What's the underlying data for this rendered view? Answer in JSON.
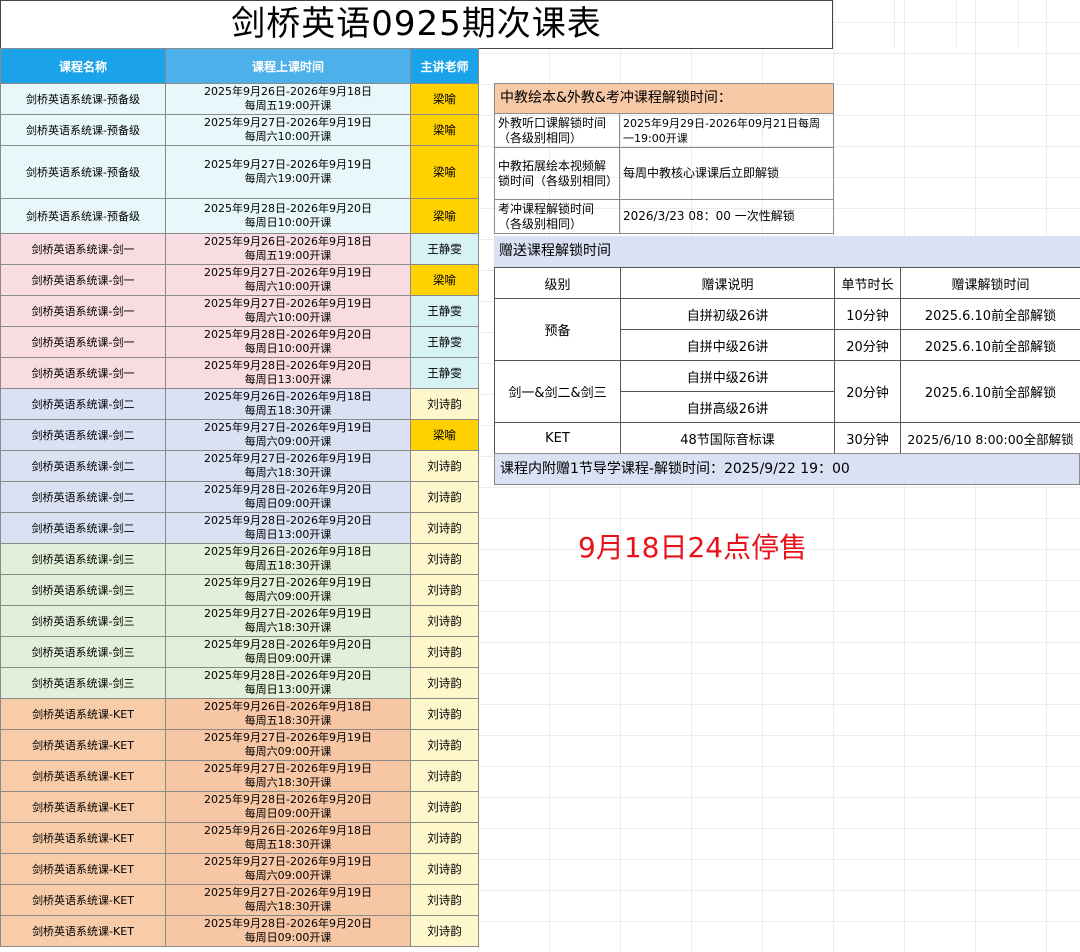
{
  "title": "剑桥英语0925期次课表",
  "schedule": {
    "headers": [
      "课程名称",
      "课程上课时间",
      "主讲老师"
    ],
    "rows": [
      {
        "name": "剑桥英语系统课-预备级",
        "date": "2025年9月26日-2026年9月18日",
        "time": "每周五19:00开课",
        "teacher": "梁喻",
        "group": "pre",
        "tcolor": "gold"
      },
      {
        "name": "剑桥英语系统课-预备级",
        "date": "2025年9月27日-2026年9月19日",
        "time": "每周六10:00开课",
        "teacher": "梁喻",
        "group": "pre",
        "tcolor": "gold"
      },
      {
        "name": "剑桥英语系统课-预备级",
        "date": "2025年9月27日-2026年9月19日",
        "time": "每周六19:00开课",
        "teacher": "梁喻",
        "group": "pre",
        "tcolor": "gold"
      },
      {
        "name": "剑桥英语系统课-预备级",
        "date": "2025年9月28日-2026年9月20日",
        "time": "每周日10:00开课",
        "teacher": "梁喻",
        "group": "pre",
        "tcolor": "gold"
      },
      {
        "name": "剑桥英语系统课-剑一",
        "date": "2025年9月26日-2026年9月18日",
        "time": "每周五19:00开课",
        "teacher": "王静雯",
        "group": "j1",
        "tcolor": "cyan"
      },
      {
        "name": "剑桥英语系统课-剑一",
        "date": "2025年9月27日-2026年9月19日",
        "time": "每周六10:00开课",
        "teacher": "梁喻",
        "group": "j1",
        "tcolor": "gold"
      },
      {
        "name": "剑桥英语系统课-剑一",
        "date": "2025年9月27日-2026年9月19日",
        "time": "每周六10:00开课",
        "teacher": "王静雯",
        "group": "j1",
        "tcolor": "cyan"
      },
      {
        "name": "剑桥英语系统课-剑一",
        "date": "2025年9月28日-2026年9月20日",
        "time": "每周日10:00开课",
        "teacher": "王静雯",
        "group": "j1",
        "tcolor": "cyan"
      },
      {
        "name": "剑桥英语系统课-剑一",
        "date": "2025年9月28日-2026年9月20日",
        "time": "每周日13:00开课",
        "teacher": "王静雯",
        "group": "j1",
        "tcolor": "cyan"
      },
      {
        "name": "剑桥英语系统课-剑二",
        "date": "2025年9月26日-2026年9月18日",
        "time": "每周五18:30开课",
        "teacher": "刘诗韵",
        "group": "j2",
        "tcolor": "cream"
      },
      {
        "name": "剑桥英语系统课-剑二",
        "date": "2025年9月27日-2026年9月19日",
        "time": "每周六09:00开课",
        "teacher": "梁喻",
        "group": "j2",
        "tcolor": "gold"
      },
      {
        "name": "剑桥英语系统课-剑二",
        "date": "2025年9月27日-2026年9月19日",
        "time": "每周六18:30开课",
        "teacher": "刘诗韵",
        "group": "j2",
        "tcolor": "cream"
      },
      {
        "name": "剑桥英语系统课-剑二",
        "date": "2025年9月28日-2026年9月20日",
        "time": "每周日09:00开课",
        "teacher": "刘诗韵",
        "group": "j2",
        "tcolor": "cream"
      },
      {
        "name": "剑桥英语系统课-剑二",
        "date": "2025年9月28日-2026年9月20日",
        "time": "每周日13:00开课",
        "teacher": "刘诗韵",
        "group": "j2",
        "tcolor": "cream"
      },
      {
        "name": "剑桥英语系统课-剑三",
        "date": "2025年9月26日-2026年9月18日",
        "time": "每周五18:30开课",
        "teacher": "刘诗韵",
        "group": "j3",
        "tcolor": "cream"
      },
      {
        "name": "剑桥英语系统课-剑三",
        "date": "2025年9月27日-2026年9月19日",
        "time": "每周六09:00开课",
        "teacher": "刘诗韵",
        "group": "j3",
        "tcolor": "cream"
      },
      {
        "name": "剑桥英语系统课-剑三",
        "date": "2025年9月27日-2026年9月19日",
        "time": "每周六18:30开课",
        "teacher": "刘诗韵",
        "group": "j3",
        "tcolor": "cream"
      },
      {
        "name": "剑桥英语系统课-剑三",
        "date": "2025年9月28日-2026年9月20日",
        "time": "每周日09:00开课",
        "teacher": "刘诗韵",
        "group": "j3",
        "tcolor": "cream"
      },
      {
        "name": "剑桥英语系统课-剑三",
        "date": "2025年9月28日-2026年9月20日",
        "time": "每周日13:00开课",
        "teacher": "刘诗韵",
        "group": "j3",
        "tcolor": "cream"
      },
      {
        "name": "剑桥英语系统课-KET",
        "date": "2025年9月26日-2026年9月18日",
        "time": "每周五18:30开课",
        "teacher": "刘诗韵",
        "group": "ket",
        "tcolor": "cream"
      },
      {
        "name": "剑桥英语系统课-KET",
        "date": "2025年9月27日-2026年9月19日",
        "time": "每周六09:00开课",
        "teacher": "刘诗韵",
        "group": "ket",
        "tcolor": "cream"
      },
      {
        "name": "剑桥英语系统课-KET",
        "date": "2025年9月27日-2026年9月19日",
        "time": "每周六18:30开课",
        "teacher": "刘诗韵",
        "group": "ket",
        "tcolor": "cream"
      },
      {
        "name": "剑桥英语系统课-KET",
        "date": "2025年9月28日-2026年9月20日",
        "time": "每周日09:00开课",
        "teacher": "刘诗韵",
        "group": "ket",
        "tcolor": "cream"
      },
      {
        "name": "剑桥英语系统课-KET",
        "date": "2025年9月26日-2026年9月18日",
        "time": "每周五18:30开课",
        "teacher": "刘诗韵",
        "group": "ket",
        "tcolor": "cream"
      },
      {
        "name": "剑桥英语系统课-KET",
        "date": "2025年9月27日-2026年9月19日",
        "time": "每周六09:00开课",
        "teacher": "刘诗韵",
        "group": "ket",
        "tcolor": "cream"
      },
      {
        "name": "剑桥英语系统课-KET",
        "date": "2025年9月27日-2026年9月19日",
        "time": "每周六18:30开课",
        "teacher": "刘诗韵",
        "group": "ket",
        "tcolor": "cream"
      },
      {
        "name": "剑桥英语系统课-KET",
        "date": "2025年9月28日-2026年9月20日",
        "time": "每周日09:00开课",
        "teacher": "刘诗韵",
        "group": "ket",
        "tcolor": "cream"
      }
    ]
  },
  "unlock": {
    "header": "中教绘本&外教&考冲课程解锁时间：",
    "rows": [
      {
        "label": "外教听口课解锁时间（各级别相同）",
        "value": "2025年9月29日-2026年09月21日每周一19:00开课"
      },
      {
        "label": "中教拓展绘本视频解锁时间（各级别相同）",
        "value": "每周中教核心课课后立即解锁"
      },
      {
        "label": "考冲课程解锁时间（各级别相同）",
        "value": "2026/3/23 08：00 一次性解锁"
      }
    ]
  },
  "gift": {
    "header": "赠送课程解锁时间",
    "columns": [
      "级别",
      "赠课说明",
      "单节时长",
      "赠课解锁时间"
    ],
    "groups": [
      {
        "level": "预备",
        "items": [
          {
            "desc": "自拼初级26讲",
            "duration": "10分钟",
            "unlock": "2025.6.10前全部解锁"
          },
          {
            "desc": "自拼中级26讲",
            "duration": "20分钟",
            "unlock": "2025.6.10前全部解锁"
          }
        ]
      },
      {
        "level": "剑一&剑二&剑三",
        "duration": "20分钟",
        "unlock": "2025.6.10前全部解锁",
        "items": [
          {
            "desc": "自拼中级26讲"
          },
          {
            "desc": "自拼高级26讲"
          }
        ]
      },
      {
        "level": "KET",
        "items": [
          {
            "desc": "48节国际音标课",
            "duration": "30分钟",
            "unlock": "2025/6/10 8:00:00全部解锁"
          }
        ]
      }
    ]
  },
  "guide": "课程内附赠1节导学课程-解锁时间：2025/9/22 19：00",
  "stop_sale": "9月18日24点停售"
}
